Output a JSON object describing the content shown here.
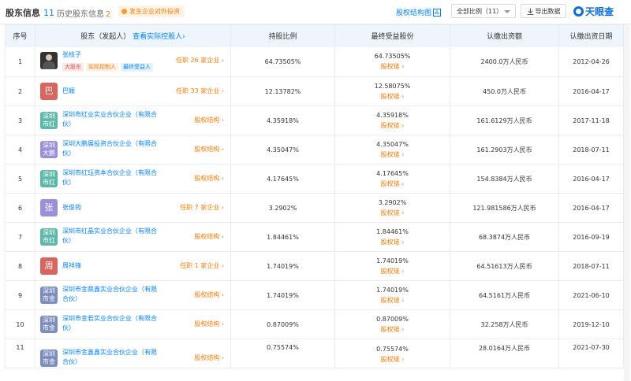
{
  "header": {
    "tab_shareholders": "股东信息",
    "tab_shareholders_count": "11",
    "tab_history": "历史股东信息",
    "tab_history_count": "2",
    "notice": "发生企业对外投资",
    "chart_link": "股权结构图",
    "select_value": "全部比例（11）",
    "export_label": "导出数据",
    "brand": "天眼查"
  },
  "columns": {
    "index": "序号",
    "holder": "股东（发起人）",
    "holder_link": "查看实际控股人",
    "ratio": "持股比例",
    "final_share": "最终受益股份",
    "capital": "认缴出资额",
    "date": "认缴出资日期"
  },
  "rows": [
    {
      "index": "1",
      "avatar": "",
      "name": "张核子",
      "right": "任职 26 家企业",
      "tags": [
        "大股东",
        "实际控制人",
        "最终受益人"
      ],
      "ratio": "64.73505%",
      "final": "64.73505%",
      "link": "股权链",
      "capital": "2400.0万人民币",
      "date": "2012-04-26"
    },
    {
      "index": "2",
      "avatar": "巴",
      "name": "巴颖",
      "right": "任职 33 家企业",
      "tags": [],
      "ratio": "12.13782%",
      "final": "12.58075%",
      "link": "股权链",
      "capital": "450.0万人民币",
      "date": "2016-04-17"
    },
    {
      "index": "3",
      "avatar": "深圳市红",
      "name": "深圳市红业实业合伙企业（有限合伙）",
      "right": "股权结构",
      "tags": [],
      "ratio": "4.35918%",
      "final": "4.35918%",
      "link": "股权链",
      "capital": "161.6129万人民币",
      "date": "2017-11-18"
    },
    {
      "index": "4",
      "avatar": "深圳大鹏",
      "name": "深圳大鹏展投资合伙企业（有限合伙）",
      "right": "股权结构",
      "tags": [],
      "ratio": "4.35047%",
      "final": "4.35047%",
      "link": "股权链",
      "capital": "161.2903万人民币",
      "date": "2018-07-11"
    },
    {
      "index": "5",
      "avatar": "深圳市红",
      "name": "深圳市红珏资本合伙企业（有限合伙）",
      "right": "股权结构",
      "tags": [],
      "ratio": "4.17645%",
      "final": "4.17645%",
      "link": "股权链",
      "capital": "154.8384万人民币",
      "date": "2016-04-17"
    },
    {
      "index": "6",
      "avatar": "张",
      "name": "张俊筠",
      "right": "任职 7 家企业",
      "tags": [],
      "ratio": "3.2902%",
      "final": "3.2902%",
      "link": "股权链",
      "capital": "121.981586万人民币",
      "date": "2016-04-17"
    },
    {
      "index": "7",
      "avatar": "深圳市红",
      "name": "深圳市红晶实业合伙企业（有限合伙）",
      "right": "股权结构",
      "tags": [],
      "ratio": "1.84461%",
      "final": "1.84461%",
      "link": "股权链",
      "capital": "68.3874万人民币",
      "date": "2016-09-19"
    },
    {
      "index": "8",
      "avatar": "周",
      "name": "周祥锋",
      "right": "任职 1 家企业",
      "tags": [],
      "ratio": "1.74019%",
      "final": "1.74019%",
      "link": "股权链",
      "capital": "64.51613万人民币",
      "date": "2018-07-11"
    },
    {
      "index": "9",
      "avatar": "深圳市金",
      "name": "深圳市金鼎鑫实业合伙企业（有限合伙）",
      "right": "股权结构",
      "tags": [],
      "ratio": "1.74019%",
      "final": "1.74019%",
      "link": "股权链",
      "capital": "64.5161万人民币",
      "date": "2021-06-10"
    },
    {
      "index": "10",
      "avatar": "深圳市金",
      "name": "深圳市金若实业合伙企业（有限合伙）",
      "right": "股权结构",
      "tags": [],
      "ratio": "0.87009%",
      "final": "0.87009%",
      "link": "股权链",
      "capital": "32.258万人民币",
      "date": "2019-12-10"
    },
    {
      "index": "11",
      "avatar": "深圳市金",
      "name": "深圳市金鑫鑫实业合伙企业（有限合伙）",
      "right": "股权结构",
      "tags": [],
      "ratio": "0.75574%",
      "final": "0.75574%",
      "link": "股权链",
      "capital": "28.0164万人民币",
      "date": "2021-07-30"
    }
  ],
  "colors": {
    "accent": "#0084ff",
    "link_orange": "#ff7a00",
    "header_bg": "#eef5fd",
    "avatar_purple": "#9b8fd9",
    "avatar_teal": "#5cb8a8",
    "avatar_red": "#d9655f",
    "avatar_slate": "#7b8cbd"
  }
}
